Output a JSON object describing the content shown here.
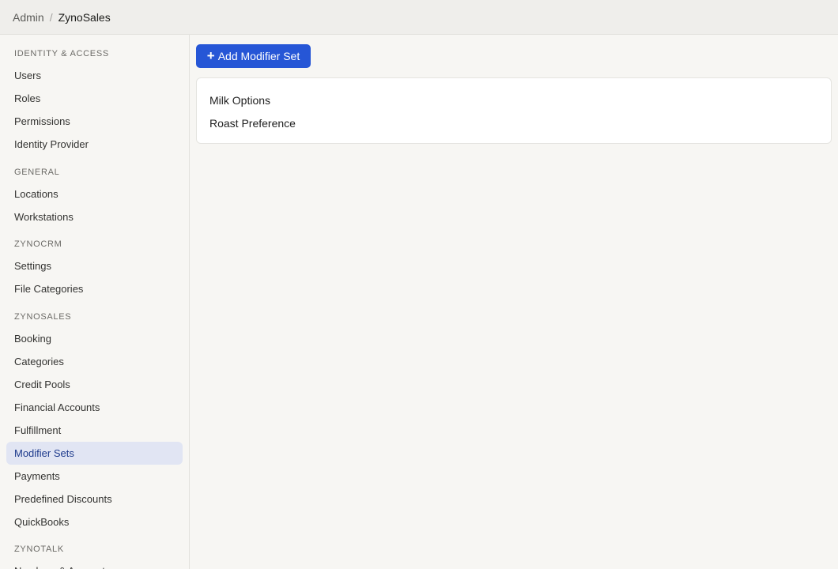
{
  "breadcrumb": {
    "root": "Admin",
    "separator": "/",
    "current": "ZynoSales"
  },
  "sidebar": {
    "sections": [
      {
        "title": "IDENTITY & ACCESS",
        "items": [
          "Users",
          "Roles",
          "Permissions",
          "Identity Provider"
        ]
      },
      {
        "title": "GENERAL",
        "items": [
          "Locations",
          "Workstations"
        ]
      },
      {
        "title": "ZYNOCRM",
        "items": [
          "Settings",
          "File Categories"
        ]
      },
      {
        "title": "ZYNOSALES",
        "items": [
          "Booking",
          "Categories",
          "Credit Pools",
          "Financial Accounts",
          "Fulfillment",
          "Modifier Sets",
          "Payments",
          "Predefined Discounts",
          "QuickBooks"
        ]
      },
      {
        "title": "ZYNOTALK",
        "items": [
          "Numbers & Accounts"
        ]
      }
    ],
    "active_item": "Modifier Sets"
  },
  "toolbar": {
    "add_label": "Add Modifier Set",
    "add_icon": "plus-icon"
  },
  "modifier_sets": [
    "Milk Options",
    "Roast Preference"
  ],
  "colors": {
    "accent": "#2656d6",
    "active_bg": "#e1e5f3",
    "active_text": "#1d3a8c"
  }
}
